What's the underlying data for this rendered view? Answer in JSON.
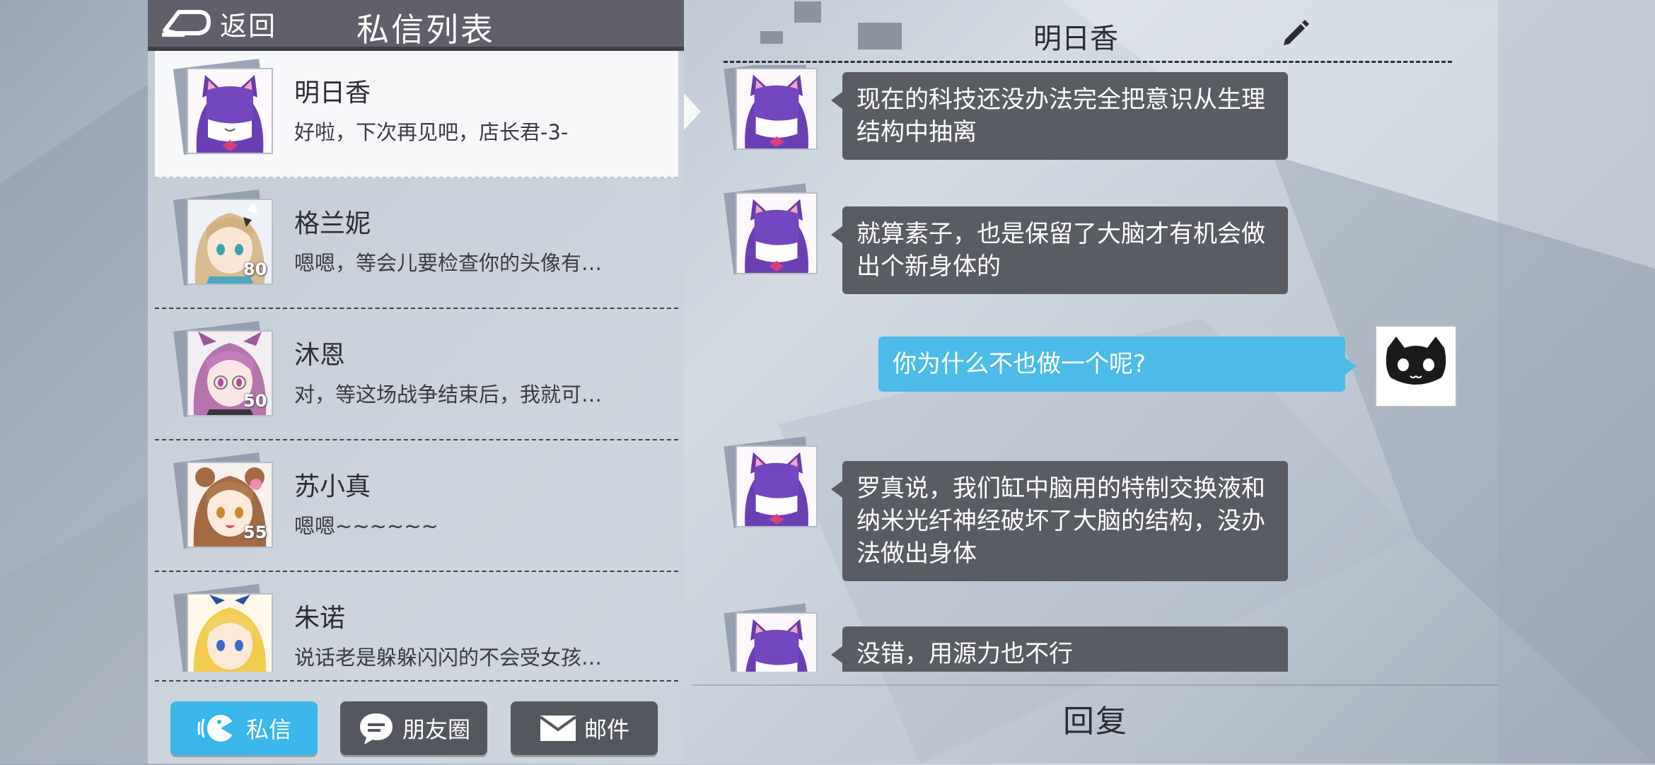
{
  "left_panel": {
    "back_label": "返回",
    "title": "私信列表",
    "contacts": [
      {
        "name": "明日香",
        "preview": "好啦，下次再见吧，店长君-3-",
        "level": "",
        "avatar": "asuka-avatar",
        "active": true
      },
      {
        "name": "格兰妮",
        "preview": "嗯嗯，等会儿要检查你的头像有…",
        "level": "80",
        "avatar": "granny-avatar"
      },
      {
        "name": "沐恩",
        "preview": "对，等这场战争结束后，我就可…",
        "level": "50",
        "avatar": "muen-avatar"
      },
      {
        "name": "苏小真",
        "preview": "嗯嗯~~~~~~",
        "level": "55",
        "avatar": "suxiaozhen-avatar"
      },
      {
        "name": "朱诺",
        "preview": "说话老是躲躲闪闪的不会受女孩…",
        "level": "",
        "avatar": "juno-avatar"
      }
    ],
    "tabs": {
      "private": "私信",
      "moments": "朋友圈",
      "mail": "邮件"
    }
  },
  "chat": {
    "title": "明日香",
    "messages": [
      {
        "sender": "other",
        "text": "现在的科技还没办法完全把意识从生理结构中抽离"
      },
      {
        "sender": "other",
        "text": "就算素子，也是保留了大脑才有机会做出个新身体的"
      },
      {
        "sender": "self",
        "text": "你为什么不也做一个呢?"
      },
      {
        "sender": "other",
        "text": "罗真说，我们缸中脑用的特制交换液和纳米光纤神经破坏了大脑的结构，没办法做出身体"
      },
      {
        "sender": "other",
        "text": "没错，用源力也不行"
      }
    ],
    "reply_label": "回复"
  },
  "colors": {
    "accent": "#3bb6ea",
    "bubble_other": "#5a5c63",
    "bubble_self": "#4dbbe7",
    "header_dark": "#5f6069"
  }
}
